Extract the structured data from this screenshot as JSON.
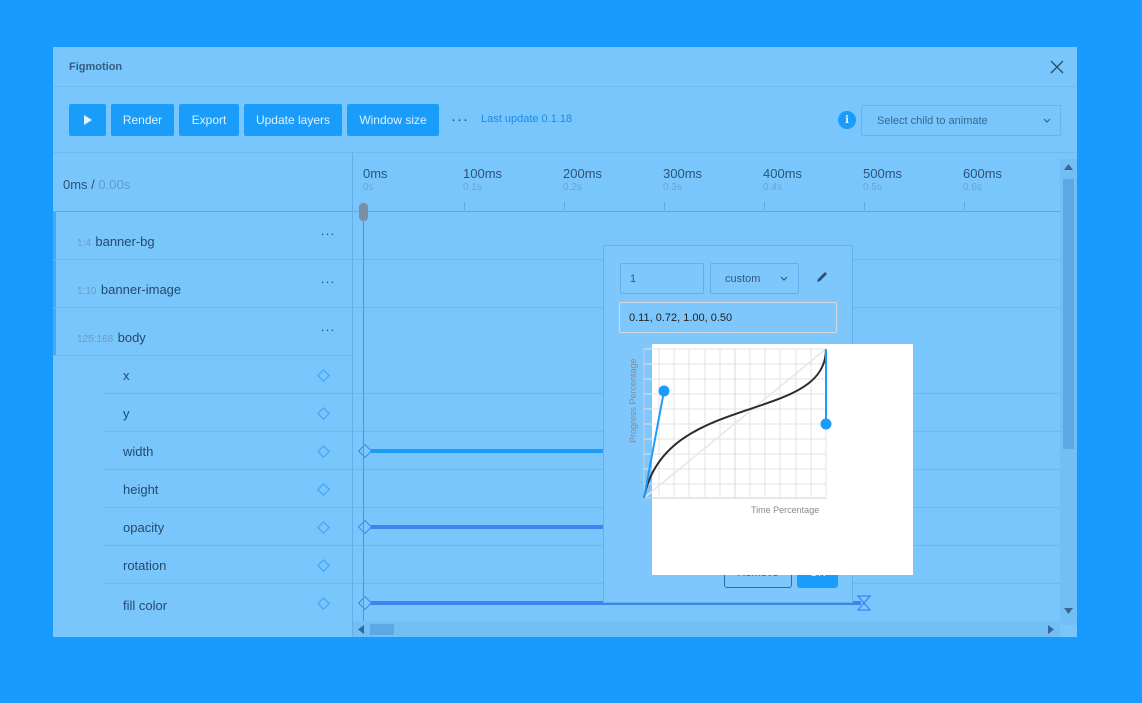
{
  "app": {
    "title": "Figmotion"
  },
  "toolbar": {
    "buttons": [
      {
        "label": "Render"
      },
      {
        "label": "Export"
      },
      {
        "label": "Update layers"
      },
      {
        "label": "Window size"
      }
    ],
    "more": "···",
    "version": "Last update 0.1.18",
    "info": "i",
    "child_select_placeholder": "Select child to animate"
  },
  "timeline": {
    "current_ms": "0ms /",
    "current_s": "0.00s",
    "ticks": [
      {
        "ms": "0ms",
        "s": "0s"
      },
      {
        "ms": "100ms",
        "s": "0.1s"
      },
      {
        "ms": "200ms",
        "s": "0.2s"
      },
      {
        "ms": "300ms",
        "s": "0.3s"
      },
      {
        "ms": "400ms",
        "s": "0.4s"
      },
      {
        "ms": "500ms",
        "s": "0.5s"
      },
      {
        "ms": "600ms",
        "s": "0.6s"
      }
    ]
  },
  "layers": [
    {
      "id": "1:4",
      "name": "banner-bg"
    },
    {
      "id": "1:10",
      "name": "banner-image"
    },
    {
      "id": "125:168",
      "name": "body"
    }
  ],
  "properties": [
    "x",
    "y",
    "width",
    "height",
    "opacity",
    "rotation",
    "fill color"
  ],
  "easing_popup": {
    "value": "1",
    "mode": "custom",
    "bezier": "0.11, 0.72, 1.00, 0.50",
    "y_label": "Progress Percentage",
    "x_label": "Time Percentage",
    "remove_label": "Remove",
    "ok_label": "OK"
  },
  "colors": {
    "background": "#189bff",
    "panel": "#79c6fd",
    "accent": "#1a9cfb",
    "curve": "#2b2b2b",
    "handle": "#1a9cfb"
  }
}
